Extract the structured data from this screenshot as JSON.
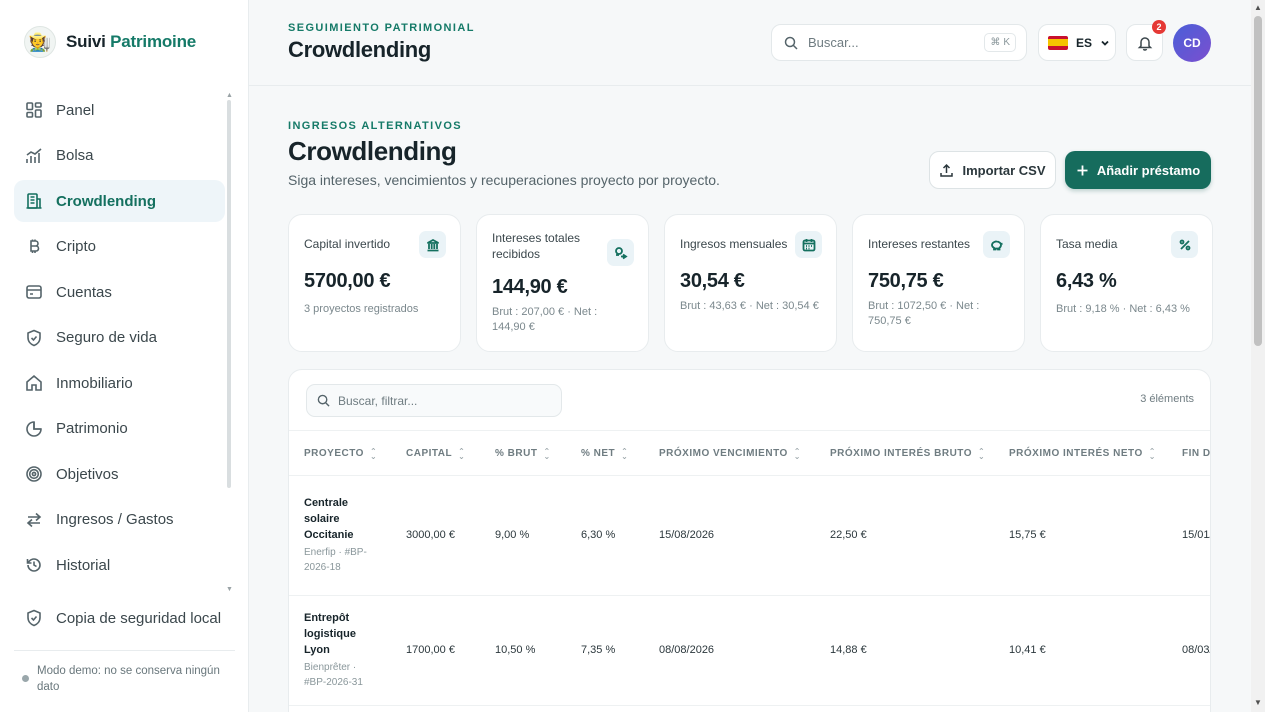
{
  "brand": {
    "name_prefix": "Suivi",
    "name_accent": "Patrimoine"
  },
  "sidebar": {
    "items": [
      {
        "label": "Panel",
        "icon": "grid-icon"
      },
      {
        "label": "Bolsa",
        "icon": "chart-icon"
      },
      {
        "label": "Crowdlending",
        "icon": "building-icon"
      },
      {
        "label": "Cripto",
        "icon": "bitcoin-icon"
      },
      {
        "label": "Cuentas",
        "icon": "wallet-icon"
      },
      {
        "label": "Seguro de vida",
        "icon": "shield-icon"
      },
      {
        "label": "Inmobiliario",
        "icon": "home-icon"
      },
      {
        "label": "Patrimonio",
        "icon": "pie-chart-icon"
      },
      {
        "label": "Objetivos",
        "icon": "target-icon"
      },
      {
        "label": "Ingresos / Gastos",
        "icon": "arrows-icon"
      },
      {
        "label": "Historial",
        "icon": "history-icon"
      }
    ],
    "backup_label": "Copia de seguridad local",
    "demo_note": "Modo demo: no se conserva ningún dato"
  },
  "header": {
    "eyebrow": "SEGUIMIENTO PATRIMONIAL",
    "title": "Crowdlending",
    "search_placeholder": "Buscar...",
    "shortcut_key": "K",
    "language": "ES",
    "notifications": "2",
    "avatar": "CD"
  },
  "page": {
    "eyebrow": "INGRESOS ALTERNATIVOS",
    "title": "Crowdlending",
    "subtitle": "Siga intereses, vencimientos y recuperaciones proyecto por proyecto.",
    "import_label": "Importar CSV",
    "add_label": "Añadir préstamo"
  },
  "cards": [
    {
      "label": "Capital invertido",
      "value": "5700,00 €",
      "sub": "3 proyectos registrados",
      "icon": "bank-icon"
    },
    {
      "label": "Intereses totales recibidos",
      "value": "144,90 €",
      "sub": "Brut : 207,00 € · Net : 144,90 €",
      "icon": "coins-icon"
    },
    {
      "label": "Ingresos mensuales",
      "value": "30,54 €",
      "sub": "Brut : 43,63 € · Net : 30,54 €",
      "icon": "calendar-icon"
    },
    {
      "label": "Intereses restantes",
      "value": "750,75 €",
      "sub": "Brut : 1072,50 € · Net : 750,75 €",
      "icon": "piggy-bank-icon"
    },
    {
      "label": "Tasa media",
      "value": "6,43 %",
      "sub": "Brut : 9,18 % · Net : 6,43 %",
      "icon": "percent-icon"
    }
  ],
  "table": {
    "filter_placeholder": "Buscar, filtrar...",
    "count": "3 éléments",
    "columns": [
      "PROYECTO",
      "CAPITAL",
      "% BRUT",
      "% NET",
      "PRÓXIMO VENCIMIENTO",
      "PRÓXIMO INTERÉS BRUTO",
      "PRÓXIMO INTERÉS NETO",
      "FIN D"
    ],
    "rows": [
      {
        "name": "Centrale solaire Occitanie",
        "meta": "Enerfip · #BP-2026-18",
        "capital": "3000,00 €",
        "brut": "9,00 %",
        "net": "6,30 %",
        "due": "15/08/2026",
        "int_brut": "22,50 €",
        "int_net": "15,75 €",
        "end": "15/01/"
      },
      {
        "name": "Entrepôt logistique Lyon",
        "meta": "Bienprêter · #BP-2026-31",
        "capital": "1700,00 €",
        "brut": "10,50 %",
        "net": "7,35 %",
        "due": "08/08/2026",
        "int_brut": "14,88 €",
        "int_net": "10,41 €",
        "end": "08/03/"
      }
    ]
  },
  "colors": {
    "accent": "#157a68",
    "primary_button": "#166c5d",
    "badge": "#e53935"
  }
}
